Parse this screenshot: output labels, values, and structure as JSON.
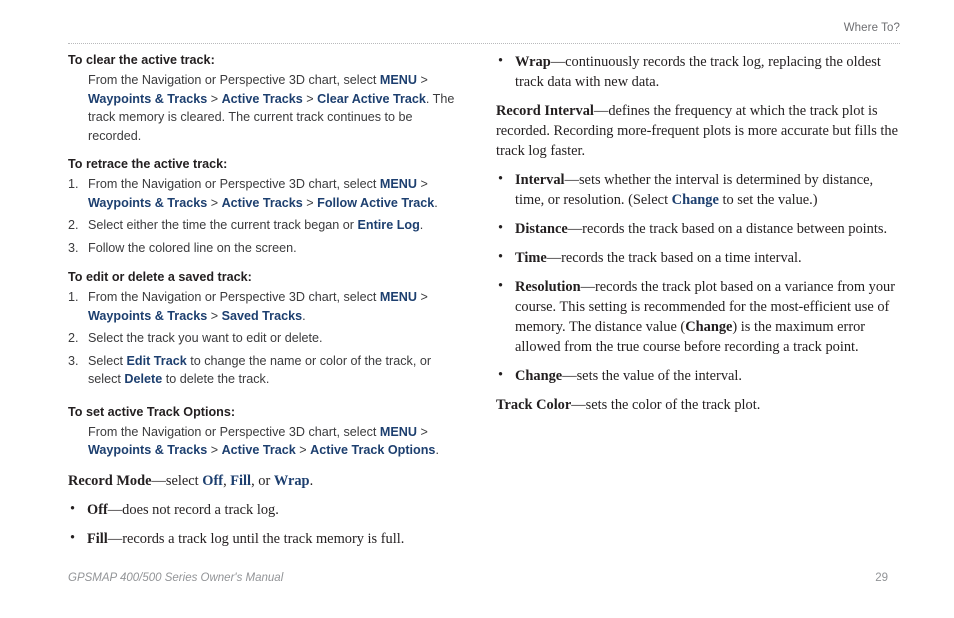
{
  "header": {
    "title": "Where To?"
  },
  "footer": {
    "manual": "GPSMAP 400/500 Series Owner's Manual",
    "page_number": "29"
  },
  "colors": {
    "ui_blue": "#1d3f6f",
    "body_text": "#231f20",
    "muted_gray": "#929497",
    "rule_gray": "#b9babc"
  },
  "left_column": {
    "clear_active_track": {
      "title": "To clear the active track:",
      "body_prefix": "From the Navigation or Perspective 3D chart, select ",
      "menu": "MENU",
      "gt1": " > ",
      "path1": "Waypoints & Tracks",
      "gt2": " > ",
      "path2": "Active Tracks",
      "gt3": " > ",
      "path3": "Clear Active Track",
      "body_suffix": ". The track memory is cleared. The current track continues to be recorded."
    },
    "retrace_active_track": {
      "title": "To retrace the active track:",
      "steps": [
        {
          "num": "1.",
          "prefix": "From the Navigation or Perspective 3D chart, select ",
          "menu": "MENU",
          "gt1": " > ",
          "path1": "Waypoints & Tracks",
          "gt2": " > ",
          "path2": "Active Tracks",
          "gt3": " > ",
          "path3": "Follow Active Track",
          "suffix": "."
        },
        {
          "num": "2.",
          "prefix": "Select either the time the current track began or ",
          "emph": "Entire Log",
          "suffix": "."
        },
        {
          "num": "3.",
          "prefix": "Follow the colored line on the screen.",
          "emph": "",
          "suffix": ""
        }
      ]
    },
    "edit_or_delete_saved_track": {
      "title": "To edit or delete a saved track:",
      "steps": [
        {
          "num": "1.",
          "prefix": "From the Navigation or Perspective 3D chart, select ",
          "menu": "MENU",
          "gt1": " > ",
          "path1": "Waypoints & Tracks",
          "gt2": " > ",
          "path2": "Saved Tracks",
          "suffix": "."
        },
        {
          "num": "2.",
          "prefix": "Select the track you want to edit or delete.",
          "emph": "",
          "suffix": ""
        },
        {
          "num": "3.",
          "prefix": "Select ",
          "emph": "Edit Track",
          "mid": " to change the name or color of the track, or select ",
          "emph2": "Delete",
          "suffix": " to delete the track."
        }
      ]
    },
    "set_active_track_options": {
      "title": "To set active Track Options:",
      "body_prefix": "From the Navigation or Perspective 3D chart, select ",
      "menu": "MENU",
      "gt1": " > ",
      "path1": "Waypoints & Tracks",
      "gt2": " > ",
      "path2": "Active Track",
      "gt3": " > ",
      "path3": "Active Track Options",
      "body_suffix": "."
    },
    "record_mode": {
      "term": "Record Mode",
      "dash": "—select ",
      "opt1": "Off",
      "comma1": ", ",
      "opt2": "Fill",
      "comma2": ", or ",
      "opt3": "Wrap",
      "end": ".",
      "bullets": [
        {
          "term": "Off",
          "text": "—does not record a track log."
        },
        {
          "term": "Fill",
          "text": "—records a track log until the track memory is full."
        }
      ]
    }
  },
  "right_column": {
    "wrap_bullet": {
      "term": "Wrap",
      "text": "—continuously records the track log, replacing the oldest track data with new data."
    },
    "record_interval": {
      "term": "Record Interval",
      "text": "—defines the frequency at which the track plot is recorded. Recording more-frequent plots is more accurate but fills the track log faster."
    },
    "interval_bullets": [
      {
        "term": "Interval",
        "text_before": "—sets whether the interval is determined by distance, time, or resolution. (Select ",
        "link": "Change",
        "text_after": " to set the value.)"
      },
      {
        "term": "Distance",
        "text_before": "—records the track based on a distance between points.",
        "link": "",
        "text_after": ""
      },
      {
        "term": "Time",
        "text_before": "—records the track based on a time interval.",
        "link": "",
        "text_after": ""
      },
      {
        "term": "Resolution",
        "text_before": "—records the track plot based on a variance from your course. This setting is recommended for the most-efficient use of memory. The distance value (",
        "bold_paren": "Change",
        "text_after": ") is the maximum error allowed from the true course before recording a track point."
      },
      {
        "term": "Change",
        "text_before": "—sets the value of the interval.",
        "link": "",
        "text_after": ""
      }
    ],
    "track_color": {
      "term": "Track Color",
      "text": "—sets the color of the track plot."
    }
  }
}
